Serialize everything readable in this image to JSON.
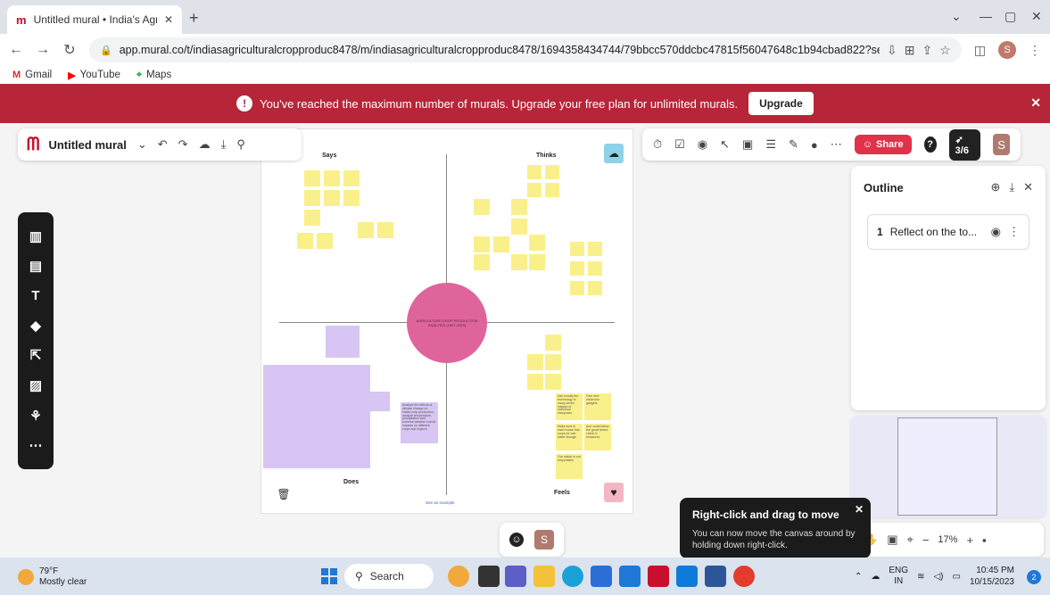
{
  "browser": {
    "tab_title": "Untitled mural • India's Agricultu",
    "url": "app.mural.co/t/indiasagriculturalcropproduc8478/m/indiasagriculturalcropproduc8478/1694358434744/79bbcc570ddcbc47815f56047648c1b94cbad822?sender=u150f913ab84dcc9219...",
    "profile_initial": "S",
    "bookmarks": [
      "Gmail",
      "YouTube",
      "Maps"
    ]
  },
  "banner": {
    "message": "You've reached the maximum number of murals. Upgrade your free plan for unlimited murals.",
    "upgrade_label": "Upgrade"
  },
  "mural": {
    "title": "Untitled mural",
    "share_label": "Share",
    "counter": "3/6",
    "user_initial": "S"
  },
  "board": {
    "says": "Says",
    "thinks": "Thinks",
    "does": "Does",
    "feels": "Feels",
    "center": "AGRICULTURE CROP PRODUCTION ANALYSIS (1997-2023)",
    "see_example": "See an example",
    "feels_notes": [
      "Use mostly the technology in many sector instead of individual manpower",
      "Give new electronic gadgets",
      "Make sure in each house has crops for rain water storage",
      "And could follow the government check & measures",
      "Our nation is our responsible"
    ],
    "does_note": "Analyze the effects of climate change on Indian crop production, analyze temperature, precipitation and extreme weather events impacts on different crops and regions"
  },
  "outline": {
    "title": "Outline",
    "items": [
      {
        "num": "1",
        "label": "Reflect on the to..."
      }
    ]
  },
  "zoom": {
    "value": "17%"
  },
  "toast": {
    "title": "Right-click and drag to move",
    "body": "You can now move the canvas around by holding down right-click."
  },
  "taskbar": {
    "temp": "79°F",
    "weather": "Mostly clear",
    "search": "Search",
    "lang1": "ENG",
    "lang2": "IN",
    "time": "10:45 PM",
    "date": "10/15/2023",
    "notif_count": "2"
  }
}
